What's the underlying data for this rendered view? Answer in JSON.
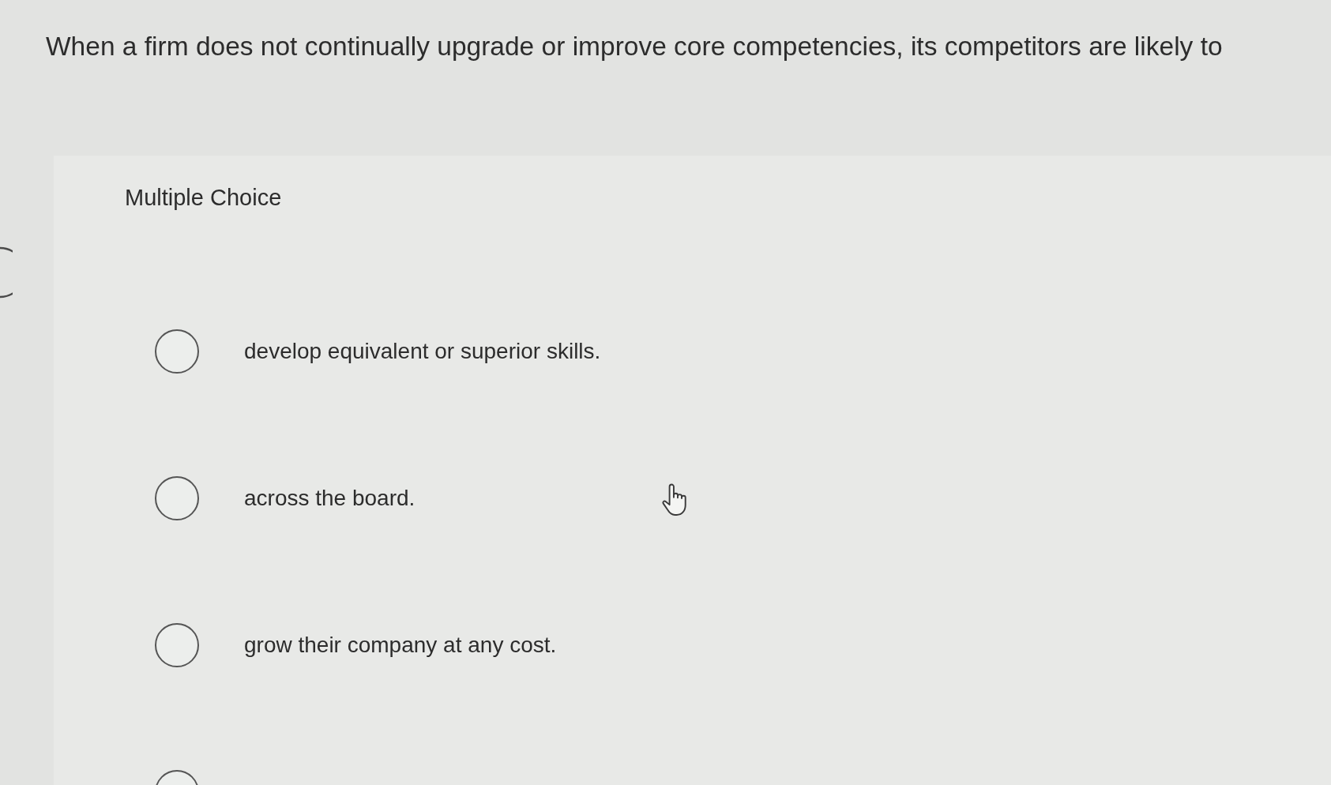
{
  "question": {
    "text": "When a firm does not continually upgrade or improve core competencies, its competitors are likely to"
  },
  "answer_area": {
    "heading": "Multiple Choice",
    "options": [
      {
        "label": "develop equivalent or superior skills.",
        "selected": false
      },
      {
        "label": "across the board.",
        "selected": false
      },
      {
        "label": "grow their company at any cost.",
        "selected": false
      },
      {
        "selected": false
      }
    ]
  }
}
